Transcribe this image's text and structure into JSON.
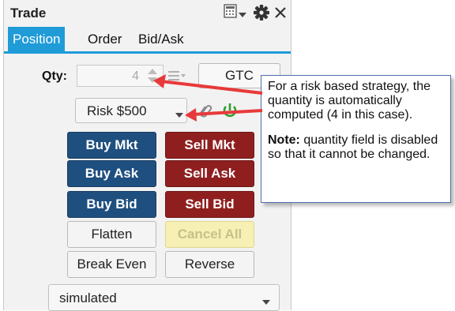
{
  "window": {
    "title": "Trade"
  },
  "tabs": [
    {
      "label": "Position",
      "active": true
    },
    {
      "label": "Order",
      "active": false
    },
    {
      "label": "Bid/Ask",
      "active": false
    }
  ],
  "qty": {
    "label": "Qty:",
    "value": "4",
    "disabled": true
  },
  "time_in_force": "GTC",
  "strategy": "Risk $500",
  "buttons": {
    "buy_mkt": "Buy Mkt",
    "sell_mkt": "Sell Mkt",
    "buy_ask": "Buy Ask",
    "sell_ask": "Sell Ask",
    "buy_bid": "Buy Bid",
    "sell_bid": "Sell Bid",
    "flatten": "Flatten",
    "cancel_all": "Cancel All",
    "break_even": "Break Even",
    "reverse": "Reverse"
  },
  "account": "simulated",
  "callout": {
    "text1": "For a risk based strategy, the quantity is automatically computed (4 in this case).",
    "note_label": "Note:",
    "note_text": " quantity field is disabled so that it cannot be changed."
  },
  "colors": {
    "accent": "#1f9bd8",
    "buy": "#1f4f7f",
    "sell": "#8f1f1f",
    "arrow": "#e8393a",
    "cancel_all_bg": "#f6f0b4",
    "link_icon": "#888888",
    "power_icon": "#2e9e2e"
  },
  "icons": [
    "grid-icon",
    "dropdown-caret-icon",
    "gear-icon",
    "close-icon",
    "spinner-arrows-icon",
    "menu-lines-icon",
    "link-icon",
    "power-icon",
    "chevron-down-icon"
  ]
}
